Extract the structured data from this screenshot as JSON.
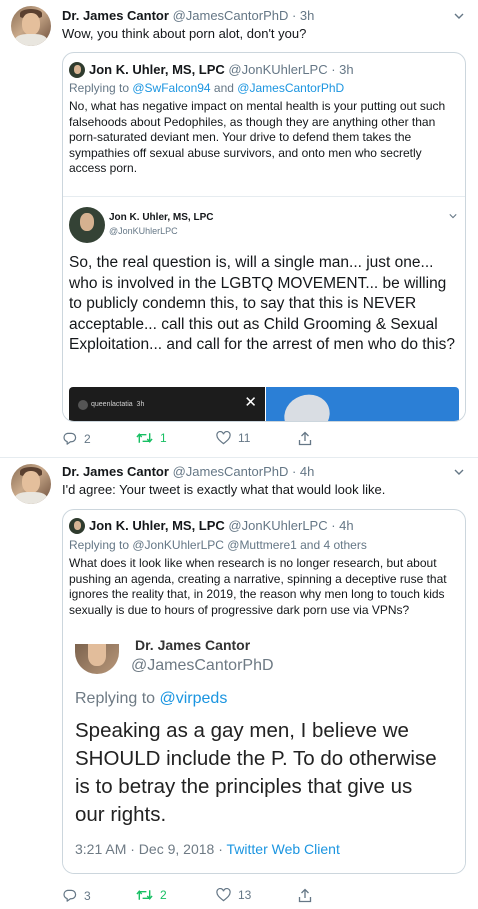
{
  "tweets": [
    {
      "author_name": "Dr. James Cantor",
      "author_meta": "@JamesCantorPhD · 3h",
      "text": "Wow, you think about porn alot, don't you?",
      "quote": {
        "author_name": "Jon K. Uhler, MS, LPC",
        "author_meta": "@JonKUhlerLPC · 3h",
        "reply_prefix": "Replying to ",
        "reply_link1": "@SwFalcon94",
        "reply_mid": " and ",
        "reply_link2": "@JamesCantorPhD",
        "text": "No, what has negative impact on mental health is your putting out such falsehoods about Pedophiles, as though they are anything other than porn-saturated deviant men. Your drive to defend them takes the sympathies off sexual abuse survivors, and onto men who secretly access porn.",
        "embed": {
          "author_name": "Jon K. Uhler, MS, LPC",
          "author_handle": "@JonKUhlerLPC",
          "text": "So, the real question is, will a single man... just one... who is involved in the LGBTQ MOVEMENT... be willing to publicly condemn this, to say that this is NEVER acceptable... call this out as Child Grooming & Sexual Exploitation... and call for the arrest of men who do this?",
          "media_label": "queenlactatia",
          "media_time": "3h",
          "close": "✕"
        }
      },
      "replies": "2",
      "retweets": "1",
      "likes": "11"
    },
    {
      "author_name": "Dr. James Cantor",
      "author_meta": "@JamesCantorPhD · 4h",
      "text": "I'd agree: Your tweet is exactly what that would look like.",
      "quote": {
        "author_name": "Jon K. Uhler, MS, LPC",
        "author_meta": "@JonKUhlerLPC · 4h",
        "reply_text": "Replying to @JonKUhlerLPC @Muttmere1 and 4 others",
        "text": "What does it look like when research is no longer research, but about pushing an agenda, creating a narrative, spinning a deceptive ruse that ignores the reality that, in 2019, the reason why men long to touch kids sexually is due to hours of progressive dark porn use via VPNs?",
        "screenshot": {
          "author_name": "Dr. James Cantor",
          "author_handle": "@JamesCantorPhD",
          "reply_prefix": "Replying to ",
          "reply_link": "@virpeds",
          "text": "Speaking as a gay men, I believe we SHOULD include the P.  To do otherwise is to betray the principles that give us our rights.",
          "timestamp": "3:21 AM · Dec 9, 2018 · ",
          "client": "Twitter Web Client"
        }
      },
      "replies": "3",
      "retweets": "2",
      "likes": "13"
    }
  ],
  "colors": {
    "link": "#1b95e0",
    "muted": "#657786",
    "retweet": "#17bf63",
    "border": "#ccd6dd"
  },
  "icons": [
    "reply-icon",
    "retweet-icon",
    "like-icon",
    "share-icon",
    "chevron-down-icon",
    "close-icon"
  ]
}
